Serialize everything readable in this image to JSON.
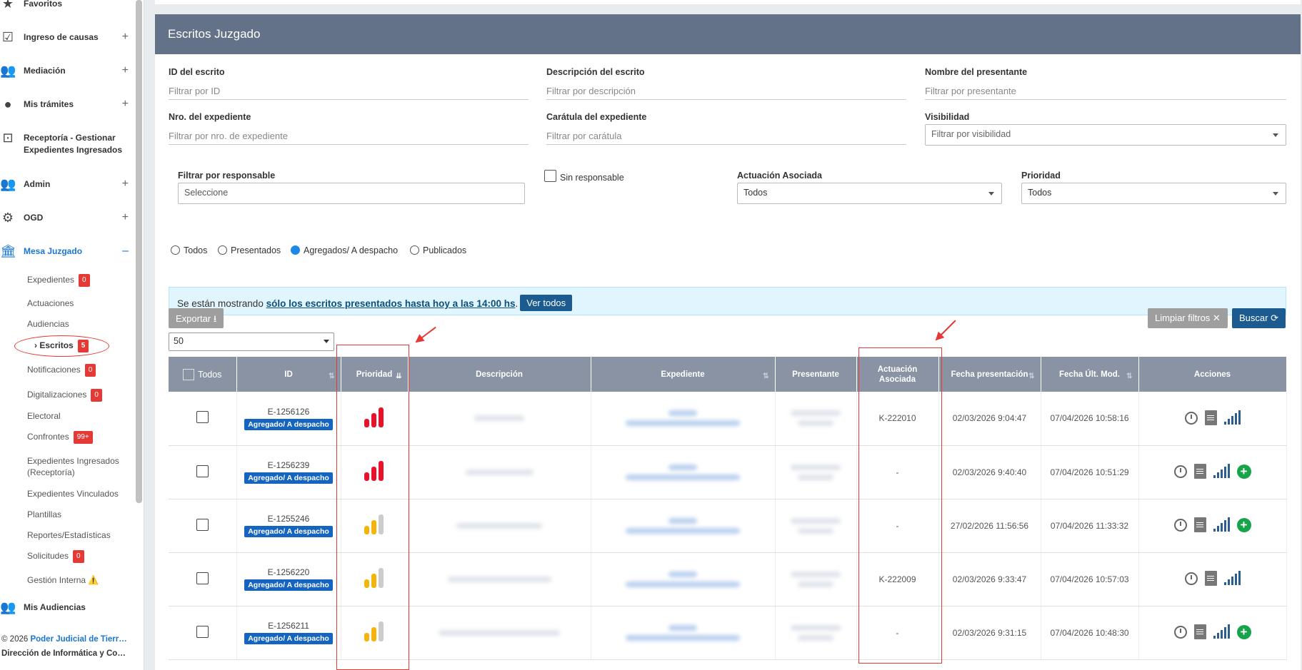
{
  "sidebar": {
    "items": [
      {
        "label": "Favoritos",
        "icon": "star-icon",
        "toggle": ""
      },
      {
        "label": "Ingreso de causas",
        "icon": "clipboard-check-icon",
        "toggle": "+"
      },
      {
        "label": "Mediación",
        "icon": "people-icon",
        "toggle": "+"
      },
      {
        "label": "Mis trámites",
        "icon": "person-icon",
        "toggle": "+"
      },
      {
        "label": "Receptoría - Gestionar Expedientes Ingresados",
        "icon": "inbox-icon",
        "toggle": ""
      },
      {
        "label": "Admin",
        "icon": "people-icon",
        "toggle": "+"
      },
      {
        "label": "OGD",
        "icon": "gear-icon",
        "toggle": "+"
      },
      {
        "label": "Mesa Juzgado",
        "icon": "bank-icon",
        "toggle": "–"
      },
      {
        "label": "Mis Audiencias",
        "icon": "people-icon",
        "toggle": ""
      }
    ],
    "sub_items": [
      {
        "label": "Expedientes",
        "badge": "0"
      },
      {
        "label": "Actuaciones",
        "badge": ""
      },
      {
        "label": "Audiencias",
        "badge": ""
      },
      {
        "label": "Escritos",
        "badge": "5"
      },
      {
        "label": "Notificaciones",
        "badge": "0"
      },
      {
        "label": "Digitalizaciones",
        "badge": "0"
      },
      {
        "label": "Electoral",
        "badge": ""
      },
      {
        "label": "Confrontes",
        "badge": "99+"
      },
      {
        "label": "Expedientes Ingresados (Receptoría)",
        "badge": ""
      },
      {
        "label": "Expedientes Vinculados",
        "badge": ""
      },
      {
        "label": "Plantillas",
        "badge": ""
      },
      {
        "label": "Reportes/Estadísticas",
        "badge": ""
      },
      {
        "label": "Solicitudes",
        "badge": "0"
      },
      {
        "label": "Gestión Interna ⚠️",
        "badge": ""
      }
    ],
    "footer_line1_prefix": "© 2026 ",
    "footer_line1_link": "Poder Judicial de Tierr…",
    "footer_line2": "Dirección de Informática y Co…"
  },
  "panel": {
    "title": "Escritos Juzgado",
    "filters": {
      "id_label": "ID del escrito",
      "id_placeholder": "Filtrar por ID",
      "desc_label": "Descripción del escrito",
      "desc_placeholder": "Filtrar por descripción",
      "presentante_label": "Nombre del presentante",
      "presentante_placeholder": "Filtrar por presentante",
      "nro_label": "Nro. del expediente",
      "nro_placeholder": "Filtrar por nro. de expediente",
      "caratula_label": "Carátula del expediente",
      "caratula_placeholder": "Filtrar por carátula",
      "visibilidad_label": "Visibilidad",
      "visibilidad_value": "Filtrar por visibilidad",
      "responsable_label": "Filtrar por responsable",
      "responsable_placeholder": "Seleccione",
      "sin_responsable": "Sin responsable",
      "actuacion_label": "Actuación Asociada",
      "actuacion_value": "Todos",
      "prioridad_label": "Prioridad",
      "prioridad_value": "Todos"
    },
    "radios": [
      {
        "label": "Todos",
        "checked": false
      },
      {
        "label": "Presentados",
        "checked": false
      },
      {
        "label": "Agregados/ A despacho",
        "checked": true
      },
      {
        "label": "Publicados",
        "checked": false
      }
    ],
    "info": {
      "prefix": "Se están mostrando ",
      "bold": "sólo los escritos presentados hasta hoy a las 14:00 hs",
      "suffix": ".",
      "button": "Ver todos"
    },
    "export_label": "Exportar",
    "clear_label": "Limpiar filtros",
    "search_label": "Buscar",
    "page_size": "50",
    "columns": [
      "Todos",
      "ID",
      "Prioridad",
      "Descripción",
      "Expediente",
      "Presentante",
      "Actuación Asociada",
      "Fecha presentación",
      "Fecha Últ. Mod.",
      "Acciones"
    ],
    "rows": [
      {
        "id": "E-1256126",
        "status": "Agregado/ A despacho",
        "priority": "alta",
        "actuacion": "K-222010",
        "fecha_presentacion": "02/03/2026 9:04:47",
        "fecha_mod": "07/04/2026 10:58:16",
        "add": false
      },
      {
        "id": "E-1256239",
        "status": "Agregado/ A despacho",
        "priority": "alta",
        "actuacion": "-",
        "fecha_presentacion": "02/03/2026 9:40:40",
        "fecha_mod": "07/04/2026 10:51:29",
        "add": true
      },
      {
        "id": "E-1255246",
        "status": "Agregado/ A despacho",
        "priority": "media",
        "actuacion": "-",
        "fecha_presentacion": "27/02/2026 11:56:56",
        "fecha_mod": "07/04/2026 11:33:32",
        "add": true
      },
      {
        "id": "E-1256220",
        "status": "Agregado/ A despacho",
        "priority": "media",
        "actuacion": "K-222009",
        "fecha_presentacion": "02/03/2026 9:33:47",
        "fecha_mod": "07/04/2026 10:57:03",
        "add": false
      },
      {
        "id": "E-1256211",
        "status": "Agregado/ A despacho",
        "priority": "media",
        "actuacion": "-",
        "fecha_presentacion": "02/03/2026 9:31:15",
        "fecha_mod": "07/04/2026 10:48:30",
        "add": true
      }
    ],
    "colors": {
      "header": "#647289",
      "priority_high": "#e8132b",
      "priority_mid": "#f5b40a",
      "priority_off": "#cccccc",
      "annotation": "#e53935"
    }
  }
}
